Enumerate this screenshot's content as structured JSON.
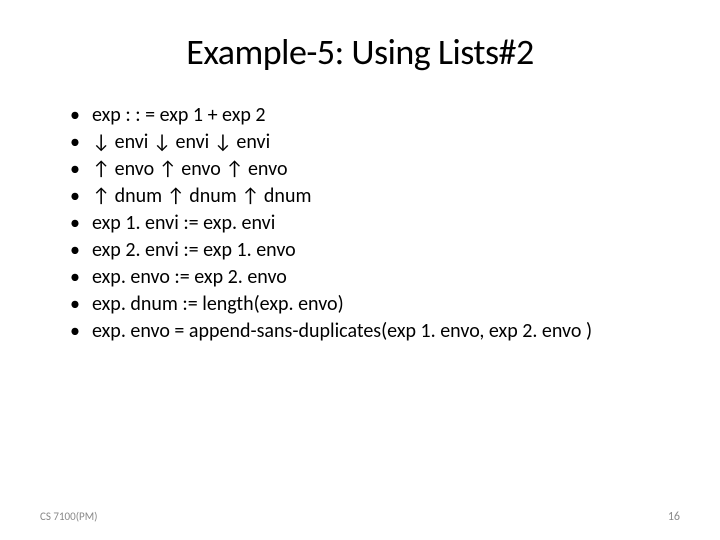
{
  "title": "Example-5: Using Lists#2",
  "bullets": [
    "exp : : = exp 1 + exp 2",
    "  ↓ envi   ↓ envi   ↓ envi",
    "  ↑ envo    ↑ envo   ↑ envo",
    "  ↑ dnum    ↑ dnum   ↑ dnum",
    "exp 1. envi := exp. envi",
    "exp 2. envi := exp 1. envo",
    "exp. envo  := exp 2. envo",
    "exp. dnum  := length(exp. envo)",
    "exp. envo =  append-sans-duplicates(exp 1. envo, exp 2. envo )"
  ],
  "footer": {
    "left": "CS 7100(PM)",
    "right": "16"
  }
}
